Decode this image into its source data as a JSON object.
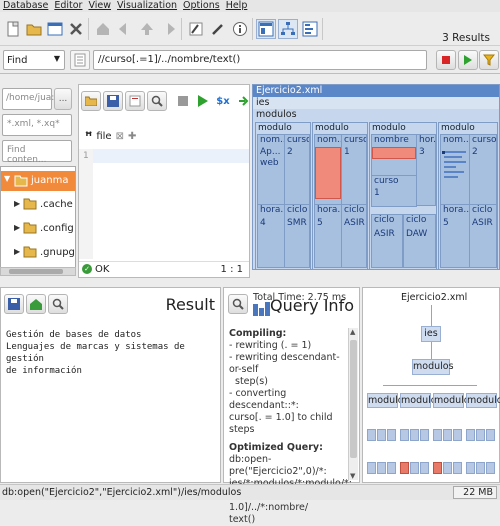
{
  "menu": [
    "Database",
    "Editor",
    "View",
    "Visualization",
    "Options",
    "Help"
  ],
  "toolbar": {
    "results": "3 Results"
  },
  "query": {
    "mode": "Find",
    "expression": "//curso[.=1]/../nombre/text()"
  },
  "files": {
    "path_placeholder": "/home/jua:",
    "filter_placeholder": "*.xml, *.xq*",
    "find_placeholder": "Find conten...",
    "items": [
      "juanma",
      ".cache",
      ".config",
      ".gnupg"
    ]
  },
  "editor": {
    "tab": "file",
    "line_number": "1",
    "status": "OK",
    "cursor": "1 : 1"
  },
  "map": {
    "title": "Ejercicio2.xml",
    "root": "ies",
    "container": "modulos",
    "cols": [
      {
        "head": "modulo",
        "a": "nom...",
        "b": "curso",
        "a_val": "Ap... web",
        "b_val": "2",
        "c": "hora...",
        "d": "ciclo",
        "c_val": "4",
        "d_val": "SMR"
      },
      {
        "head": "modulo",
        "a": "nom...",
        "b": "curso",
        "a_val": "",
        "b_val": "1",
        "c": "hora...",
        "d": "ciclo",
        "c_val": "5",
        "d_val": "ASIR"
      },
      {
        "head": "modulo",
        "a": "nombre",
        "b": "hor...",
        "a_val": "",
        "b_val": "3",
        "c": "ciclo",
        "d": "",
        "c_val": "ASIR",
        "d_val": "DAW",
        "e": "curso",
        "e_val": "1",
        "f": "ciclo"
      },
      {
        "head": "modulo",
        "a": "nom...",
        "b": "curso",
        "a_val": "",
        "b_val": "2",
        "c": "hora...",
        "d": "ciclo",
        "c_val": "5",
        "d_val": "ASIR"
      }
    ]
  },
  "result": {
    "title": "Result",
    "lines": [
      "Gestión de bases de datos",
      "Lenguajes de marcas y sistemas de gestión",
      "de información"
    ]
  },
  "info": {
    "total_time": "Total Time: 2.75 ms",
    "title": "Query Info",
    "compiling": "Compiling:",
    "steps": [
      "- rewriting (. = 1)",
      "- rewriting descendant-or-self",
      "  step(s)",
      "- converting descendant::*:",
      "curso[. = 1.0] to child steps"
    ],
    "optimized": "Optimized Query:",
    "opt_text": [
      "db:open-pre(\"Ejercicio2\",0)/*:",
      "ies/*:modulos/*:modulo/*:",
      "curso[. = 1.0]/../*:nombre/",
      "text()"
    ]
  },
  "tree": {
    "root": "Ejercicio2.xml",
    "ies": "ies",
    "modulos": "modulos",
    "modulo": "modulo"
  },
  "status": {
    "path": "db:open(\"Ejercicio2\",\"Ejercicio2.xml\")/ies/modulos",
    "memory": "22 MB"
  }
}
